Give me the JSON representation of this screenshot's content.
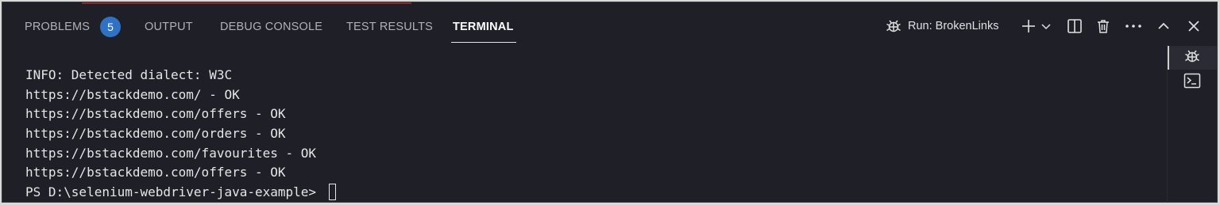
{
  "panel": {
    "tabs": [
      {
        "label": "PROBLEMS",
        "badge": "5"
      },
      {
        "label": "OUTPUT"
      },
      {
        "label": "DEBUG CONSOLE"
      },
      {
        "label": "TEST RESULTS"
      },
      {
        "label": "TERMINAL",
        "active": true
      }
    ],
    "actions": {
      "run_label": "Run: BrokenLinks",
      "icons": [
        "debug-icon",
        "plus-icon",
        "chevron-down-icon",
        "split-icon",
        "trash-icon",
        "ellipsis-icon",
        "chevron-up-icon",
        "close-icon"
      ]
    },
    "side_terminals": [
      "debug-icon",
      "terminal-icon"
    ]
  },
  "terminal": {
    "lines": [
      "INFO: Detected dialect: W3C",
      "https://bstackdemo.com/ - OK",
      "https://bstackdemo.com/offers - OK",
      "https://bstackdemo.com/orders - OK",
      "https://bstackdemo.com/favourites - OK",
      "https://bstackdemo.com/offers - OK"
    ],
    "prompt": "PS D:\\selenium-webdriver-java-example> "
  },
  "colors": {
    "background": "#1e1f27",
    "badge": "#2f72c4",
    "text": "#e6e6e6"
  }
}
